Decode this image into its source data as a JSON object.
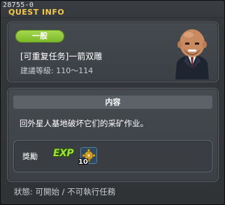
{
  "window": {
    "id_label": "28755-0",
    "title": "QUEST INFO"
  },
  "quest": {
    "category": "一般",
    "name": "[可重复任务]一箭双雕",
    "level_range": "建議等級: 110〜114",
    "npc_icon": "bald-man-in-suit-portrait"
  },
  "content": {
    "header": "内容",
    "description": "回外星人基地破坏它们的采矿作业。"
  },
  "rewards": {
    "label": "獎勵",
    "exp_label": "EXP",
    "item": {
      "icon": "gold-gear-icon",
      "count": "10"
    }
  },
  "status": {
    "text": "狀態: 可開始 / 不可執行任務"
  },
  "colors": {
    "title": "#f2c94c",
    "badge": "#8cc83a",
    "exp": "#9be33b"
  }
}
